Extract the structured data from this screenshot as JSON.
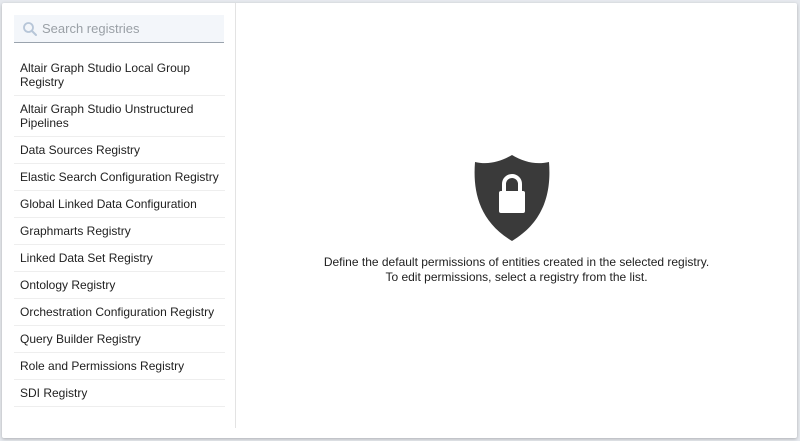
{
  "search": {
    "placeholder": "Search registries",
    "value": ""
  },
  "registries": [
    {
      "label": "Altair Graph Studio Local Group Registry"
    },
    {
      "label": "Altair Graph Studio Unstructured Pipelines"
    },
    {
      "label": "Data Sources Registry"
    },
    {
      "label": "Elastic Search Configuration Registry"
    },
    {
      "label": "Global Linked Data Configuration"
    },
    {
      "label": "Graphmarts Registry"
    },
    {
      "label": "Linked Data Set Registry"
    },
    {
      "label": "Ontology Registry"
    },
    {
      "label": "Orchestration Configuration Registry"
    },
    {
      "label": "Query Builder Registry"
    },
    {
      "label": "Role and Permissions Registry"
    },
    {
      "label": "SDI Registry"
    }
  ],
  "empty_state": {
    "icon": "shield-lock-icon",
    "line1": "Define the default permissions of entities created in the selected registry.",
    "line2": "To edit permissions, select a registry from the list."
  },
  "colors": {
    "shield": "#3a3a3a",
    "search_bg": "#f3f6fa",
    "search_icon": "#b7c6d8"
  }
}
